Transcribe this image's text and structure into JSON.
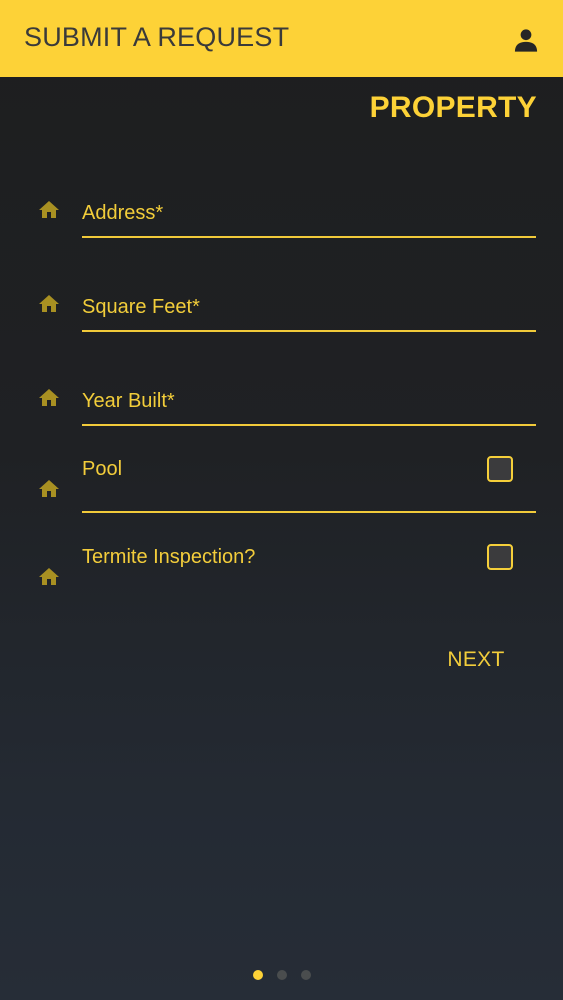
{
  "appbar": {
    "title": "SUBMIT A REQUEST",
    "profile_icon": "person-icon"
  },
  "section": {
    "title": "PROPERTY"
  },
  "fields": [
    {
      "placeholder": "Address*",
      "value": "",
      "icon": "home-icon"
    },
    {
      "placeholder": "Square Feet*",
      "value": "",
      "icon": "home-icon"
    },
    {
      "placeholder": "Year Built*",
      "value": "",
      "icon": "home-icon"
    }
  ],
  "checks": [
    {
      "label": "Pool",
      "checked": false,
      "icon": "home-icon"
    },
    {
      "label": "Termite Inspection?",
      "checked": false,
      "icon": "home-icon"
    }
  ],
  "actions": {
    "next_label": "NEXT"
  },
  "pager": {
    "pages": 3,
    "current": 1
  },
  "colors": {
    "accent": "#fdd237",
    "background": "#1f1f20",
    "checkbox_fill": "#3b3b3d",
    "inactive_dot": "#4a4d4e"
  }
}
